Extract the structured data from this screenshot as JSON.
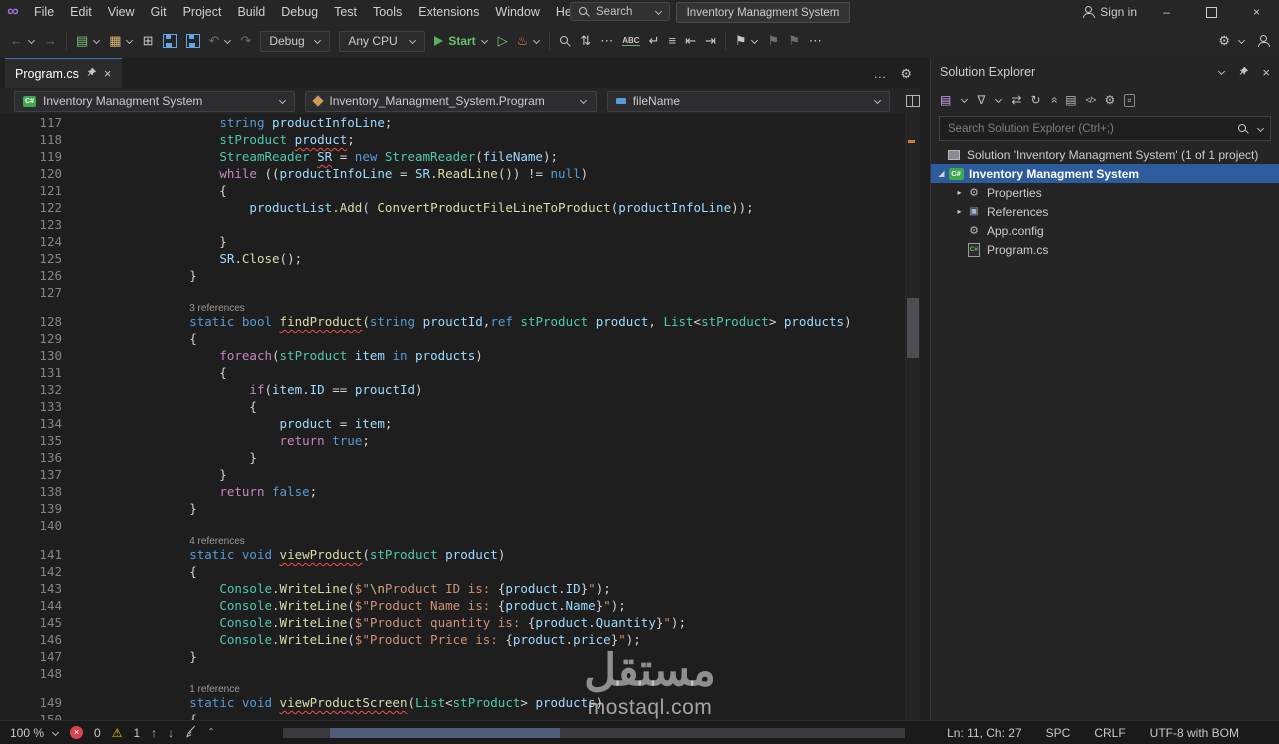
{
  "colors": {
    "accent_blue": "#2d5c9c",
    "start_green": "#57b05b",
    "error_red": "#d64550",
    "warning_yellow": "#f2cc0c",
    "logo_purple": "#9a6fd6"
  },
  "title_bar": {
    "menus": [
      "File",
      "Edit",
      "View",
      "Git",
      "Project",
      "Build",
      "Debug",
      "Test",
      "Tools",
      "Extensions",
      "Window",
      "Help"
    ],
    "search_placeholder": "Search",
    "window_title": "Inventory Managment System",
    "sign_in": "Sign in"
  },
  "toolbar": {
    "debug_config": "Debug",
    "platform": "Any CPU",
    "start_label": "Start",
    "spell_label": "ABC"
  },
  "tabs": {
    "active_label": "Program.cs"
  },
  "breadcrumb": {
    "project": "Inventory Managment System",
    "type": "Inventory_Managment_System.Program",
    "member": "fileName"
  },
  "editor": {
    "lines": [
      {
        "n": "117",
        "t": [
          [
            "pn",
            "            "
          ],
          [
            "kw",
            "string"
          ],
          [
            "pn",
            " "
          ],
          [
            "vr",
            "productInfoLine"
          ],
          [
            "pn",
            ";"
          ]
        ]
      },
      {
        "n": "118",
        "t": [
          [
            "pn",
            "            "
          ],
          [
            "ty",
            "stProduct"
          ],
          [
            "pn",
            " "
          ],
          [
            "vr sq",
            "product"
          ],
          [
            "pn",
            ";"
          ]
        ]
      },
      {
        "n": "119",
        "t": [
          [
            "pn",
            "            "
          ],
          [
            "ty",
            "StreamReader"
          ],
          [
            "pn",
            " "
          ],
          [
            "vr sq",
            "SR"
          ],
          [
            "pn",
            " = "
          ],
          [
            "kw",
            "new"
          ],
          [
            "pn",
            " "
          ],
          [
            "ty",
            "StreamReader"
          ],
          [
            "pn",
            "("
          ],
          [
            "vr",
            "fileName"
          ],
          [
            "pn",
            ");"
          ]
        ]
      },
      {
        "n": "120",
        "t": [
          [
            "pn",
            "            "
          ],
          [
            "cf",
            "while"
          ],
          [
            "pn",
            " (("
          ],
          [
            "vr",
            "productInfoLine"
          ],
          [
            "pn",
            " = "
          ],
          [
            "vr",
            "SR"
          ],
          [
            "pn",
            "."
          ],
          [
            "mt",
            "ReadLine"
          ],
          [
            "pn",
            "()) != "
          ],
          [
            "kw",
            "null"
          ],
          [
            "pn",
            ")"
          ]
        ]
      },
      {
        "n": "121",
        "t": [
          [
            "pn",
            "            {"
          ]
        ]
      },
      {
        "n": "122",
        "t": [
          [
            "pn",
            "                "
          ],
          [
            "vr",
            "productList"
          ],
          [
            "pn",
            "."
          ],
          [
            "mt",
            "Add"
          ],
          [
            "pn",
            "( "
          ],
          [
            "mt",
            "ConvertProductFileLineToProduct"
          ],
          [
            "pn",
            "("
          ],
          [
            "vr",
            "productInfoLine"
          ],
          [
            "pn",
            "));"
          ]
        ]
      },
      {
        "n": "123",
        "t": []
      },
      {
        "n": "124",
        "t": [
          [
            "pn",
            "            }"
          ]
        ]
      },
      {
        "n": "125",
        "t": [
          [
            "pn",
            "            "
          ],
          [
            "vr",
            "SR"
          ],
          [
            "pn",
            "."
          ],
          [
            "mt",
            "Close"
          ],
          [
            "pn",
            "();"
          ]
        ]
      },
      {
        "n": "126",
        "t": [
          [
            "pn",
            "        }"
          ]
        ]
      },
      {
        "n": "127",
        "t": []
      },
      {
        "n": "",
        "ref": true,
        "t": [
          [
            "rs",
            "        "
          ],
          [
            "rf",
            "3 references"
          ]
        ]
      },
      {
        "n": "128",
        "t": [
          [
            "pn",
            "        "
          ],
          [
            "kw",
            "static"
          ],
          [
            "pn",
            " "
          ],
          [
            "kw",
            "bool"
          ],
          [
            "pn",
            " "
          ],
          [
            "mt sq",
            "findProduct"
          ],
          [
            "pn",
            "("
          ],
          [
            "kw",
            "string"
          ],
          [
            "pn",
            " "
          ],
          [
            "vr",
            "prouctId"
          ],
          [
            "pn",
            ","
          ],
          [
            "kw",
            "ref"
          ],
          [
            "pn",
            " "
          ],
          [
            "ty",
            "stProduct"
          ],
          [
            "pn",
            " "
          ],
          [
            "vr",
            "product"
          ],
          [
            "pn",
            ", "
          ],
          [
            "ty",
            "List"
          ],
          [
            "pn",
            "<"
          ],
          [
            "ty",
            "stProduct"
          ],
          [
            "pn",
            "> "
          ],
          [
            "vr",
            "products"
          ],
          [
            "pn",
            ")"
          ]
        ]
      },
      {
        "n": "129",
        "t": [
          [
            "pn",
            "        {"
          ]
        ]
      },
      {
        "n": "130",
        "t": [
          [
            "pn",
            "            "
          ],
          [
            "cf",
            "foreach"
          ],
          [
            "pn",
            "("
          ],
          [
            "ty",
            "stProduct"
          ],
          [
            "pn",
            " "
          ],
          [
            "vr",
            "item"
          ],
          [
            "pn",
            " "
          ],
          [
            "kw",
            "in"
          ],
          [
            "pn",
            " "
          ],
          [
            "vr",
            "products"
          ],
          [
            "pn",
            ")"
          ]
        ]
      },
      {
        "n": "131",
        "t": [
          [
            "pn",
            "            {"
          ]
        ]
      },
      {
        "n": "132",
        "t": [
          [
            "pn",
            "                "
          ],
          [
            "cf",
            "if"
          ],
          [
            "pn",
            "("
          ],
          [
            "vr",
            "item"
          ],
          [
            "pn",
            "."
          ],
          [
            "vr",
            "ID"
          ],
          [
            "pn",
            " == "
          ],
          [
            "vr",
            "prouctId"
          ],
          [
            "pn",
            ")"
          ]
        ]
      },
      {
        "n": "133",
        "t": [
          [
            "pn",
            "                {"
          ]
        ]
      },
      {
        "n": "134",
        "t": [
          [
            "pn",
            "                    "
          ],
          [
            "vr",
            "product"
          ],
          [
            "pn",
            " = "
          ],
          [
            "vr",
            "item"
          ],
          [
            "pn",
            ";"
          ]
        ]
      },
      {
        "n": "135",
        "t": [
          [
            "pn",
            "                    "
          ],
          [
            "cf",
            "return"
          ],
          [
            "pn",
            " "
          ],
          [
            "kw",
            "true"
          ],
          [
            "pn",
            ";"
          ]
        ]
      },
      {
        "n": "136",
        "t": [
          [
            "pn",
            "                }"
          ]
        ]
      },
      {
        "n": "137",
        "t": [
          [
            "pn",
            "            }"
          ]
        ]
      },
      {
        "n": "138",
        "t": [
          [
            "pn",
            "            "
          ],
          [
            "cf",
            "return"
          ],
          [
            "pn",
            " "
          ],
          [
            "kw",
            "false"
          ],
          [
            "pn",
            ";"
          ]
        ]
      },
      {
        "n": "139",
        "t": [
          [
            "pn",
            "        }"
          ]
        ]
      },
      {
        "n": "140",
        "t": []
      },
      {
        "n": "",
        "ref": true,
        "t": [
          [
            "rs",
            "        "
          ],
          [
            "rf",
            "4 references"
          ]
        ]
      },
      {
        "n": "141",
        "t": [
          [
            "pn",
            "        "
          ],
          [
            "kw",
            "static"
          ],
          [
            "pn",
            " "
          ],
          [
            "kw",
            "void"
          ],
          [
            "pn",
            " "
          ],
          [
            "mt sq",
            "viewProduct"
          ],
          [
            "pn",
            "("
          ],
          [
            "ty",
            "stProduct"
          ],
          [
            "pn",
            " "
          ],
          [
            "vr",
            "product"
          ],
          [
            "pn",
            ")"
          ]
        ]
      },
      {
        "n": "142",
        "t": [
          [
            "pn",
            "        {"
          ]
        ]
      },
      {
        "n": "143",
        "t": [
          [
            "pn",
            "            "
          ],
          [
            "ty",
            "Console"
          ],
          [
            "pn",
            "."
          ],
          [
            "mt",
            "WriteLine"
          ],
          [
            "pn",
            "("
          ],
          [
            "st",
            "$\""
          ],
          [
            "es",
            "\\n"
          ],
          [
            "st",
            "Product ID is: "
          ],
          [
            "pn",
            "{"
          ],
          [
            "vr",
            "product"
          ],
          [
            "pn",
            "."
          ],
          [
            "vr",
            "ID"
          ],
          [
            "pn",
            "}"
          ],
          [
            "st",
            "\""
          ],
          [
            "pn",
            ");"
          ]
        ]
      },
      {
        "n": "144",
        "t": [
          [
            "pn",
            "            "
          ],
          [
            "ty",
            "Console"
          ],
          [
            "pn",
            "."
          ],
          [
            "mt",
            "WriteLine"
          ],
          [
            "pn",
            "("
          ],
          [
            "st",
            "$\"Product Name is: "
          ],
          [
            "pn",
            "{"
          ],
          [
            "vr",
            "product"
          ],
          [
            "pn",
            "."
          ],
          [
            "vr",
            "Name"
          ],
          [
            "pn",
            "}"
          ],
          [
            "st",
            "\""
          ],
          [
            "pn",
            ");"
          ]
        ]
      },
      {
        "n": "145",
        "t": [
          [
            "pn",
            "            "
          ],
          [
            "ty",
            "Console"
          ],
          [
            "pn",
            "."
          ],
          [
            "mt",
            "WriteLine"
          ],
          [
            "pn",
            "("
          ],
          [
            "st",
            "$\"Product quantity is: "
          ],
          [
            "pn",
            "{"
          ],
          [
            "vr",
            "product"
          ],
          [
            "pn",
            "."
          ],
          [
            "vr",
            "Quantity"
          ],
          [
            "pn",
            "}"
          ],
          [
            "st",
            "\""
          ],
          [
            "pn",
            ");"
          ]
        ]
      },
      {
        "n": "146",
        "t": [
          [
            "pn",
            "            "
          ],
          [
            "ty",
            "Console"
          ],
          [
            "pn",
            "."
          ],
          [
            "mt",
            "WriteLine"
          ],
          [
            "pn",
            "("
          ],
          [
            "st",
            "$\"Product Price is: "
          ],
          [
            "pn",
            "{"
          ],
          [
            "vr",
            "product"
          ],
          [
            "pn",
            "."
          ],
          [
            "vr",
            "price"
          ],
          [
            "pn",
            "}"
          ],
          [
            "st",
            "\""
          ],
          [
            "pn",
            ");"
          ]
        ]
      },
      {
        "n": "147",
        "t": [
          [
            "pn",
            "        }"
          ]
        ]
      },
      {
        "n": "148",
        "t": []
      },
      {
        "n": "",
        "ref": true,
        "t": [
          [
            "rs",
            "        "
          ],
          [
            "rf",
            "1 reference"
          ]
        ]
      },
      {
        "n": "149",
        "t": [
          [
            "pn",
            "        "
          ],
          [
            "kw",
            "static"
          ],
          [
            "pn",
            " "
          ],
          [
            "kw",
            "void"
          ],
          [
            "pn",
            " "
          ],
          [
            "mt sq",
            "viewProductScreen"
          ],
          [
            "pn",
            "("
          ],
          [
            "ty",
            "List"
          ],
          [
            "pn",
            "<"
          ],
          [
            "ty",
            "stProduct"
          ],
          [
            "pn",
            "> "
          ],
          [
            "vr",
            "products"
          ],
          [
            "pn",
            ")"
          ]
        ]
      },
      {
        "n": "150",
        "t": [
          [
            "pn",
            "        {"
          ]
        ]
      }
    ]
  },
  "solution_explorer": {
    "title": "Solution Explorer",
    "search_placeholder": "Search Solution Explorer (Ctrl+;)",
    "items": [
      {
        "name": "solution",
        "label": "Solution 'Inventory Managment System' (1 of 1 project)",
        "icon": "solution",
        "pad": 2,
        "expander": "none",
        "selected": false
      },
      {
        "name": "project",
        "label": "Inventory Managment System",
        "icon": "csproj",
        "pad": 4,
        "expander": "open",
        "selected": true
      },
      {
        "name": "properties",
        "label": "Properties",
        "icon": "properties",
        "pad": 22,
        "expander": "closed",
        "selected": false
      },
      {
        "name": "references",
        "label": "References",
        "icon": "references",
        "pad": 22,
        "expander": "closed",
        "selected": false
      },
      {
        "name": "app-config",
        "label": "App.config",
        "icon": "config",
        "pad": 22,
        "expander": "none",
        "selected": false
      },
      {
        "name": "program-cs",
        "label": "Program.cs",
        "icon": "csfile",
        "pad": 22,
        "expander": "none",
        "selected": false
      }
    ]
  },
  "status_bar": {
    "zoom": "100 %",
    "errors": "0",
    "warnings": "1",
    "line_col": "Ln: 11, Ch: 27",
    "spaces": "SPC",
    "line_ending": "CRLF",
    "encoding": "UTF-8 with BOM"
  },
  "watermark": {
    "arabic": "مستقل",
    "domain": "mostaql.com"
  },
  "icon_glyphs": {
    "vs-logo": "∞",
    "back": "←",
    "forward": "→",
    "new-file": "▤",
    "open-file": "▦",
    "add-item": "⊞",
    "undo": "↶",
    "redo": "↷",
    "play-outline": "▷",
    "hot-reload": "♨",
    "updown": "⇅",
    "wrap": "↵",
    "lines": "≡",
    "indent-out": "⇤",
    "indent-in": "⇥",
    "bookmark": "⚑",
    "overflow": "⋯",
    "ellipsis": "…",
    "gear": "⚙",
    "doc-switch": "▤",
    "filter": "∇",
    "sync": "⇄",
    "refresh": "↻",
    "collapse": "»",
    "show-all": "▤",
    "view-code": "</>",
    "properties": "⚙",
    "preview": "▫",
    "up": "↑",
    "down": "↓",
    "caret": "ˆ",
    "minimize": "–",
    "close": "×",
    "refs": "▣"
  }
}
